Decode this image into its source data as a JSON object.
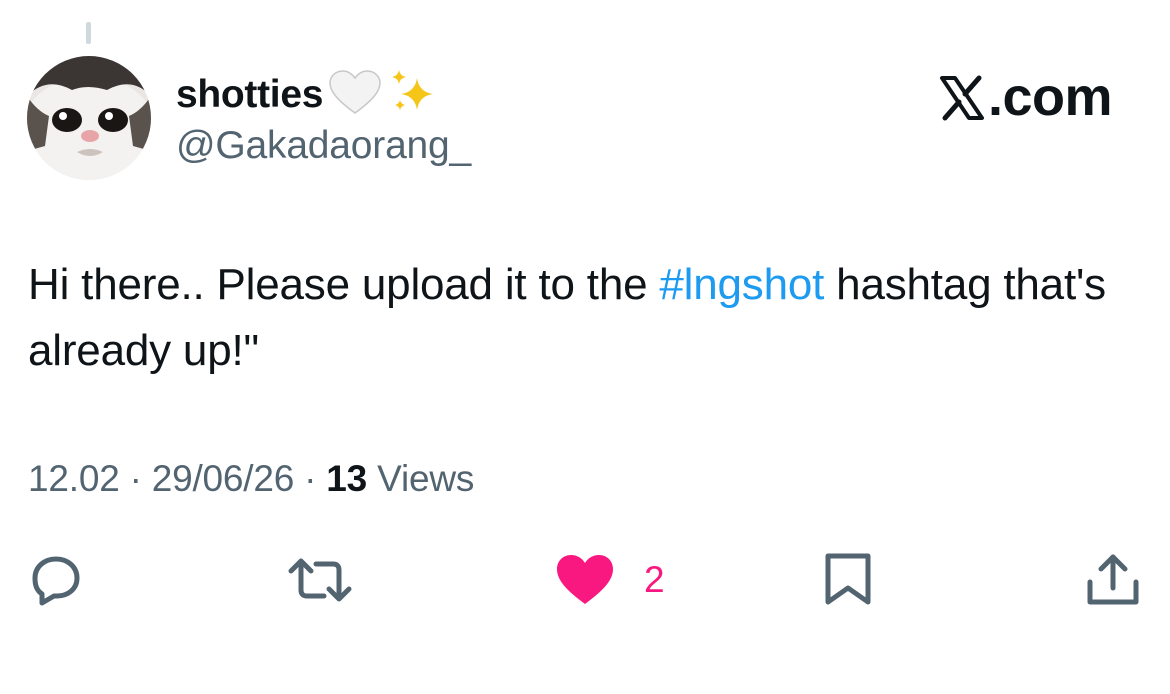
{
  "post": {
    "author": {
      "display_name": "shotties",
      "name_emojis": [
        "white-heart",
        "sparkles"
      ],
      "handle": "@Gakadaorang_",
      "avatar": "cat-face-avatar"
    },
    "brand": {
      "icon": "x-logo",
      "label": ".com"
    },
    "text": {
      "before": "Hi there.. Please upload it to the ",
      "hashtag": "#lngshot",
      "after": " hashtag that's already up!\""
    },
    "meta": {
      "time": "12.02",
      "separator": "·",
      "date": "29/06/26",
      "views_count": "13",
      "views_label": "Views"
    },
    "actions": {
      "reply_icon": "reply-icon",
      "repost_icon": "repost-icon",
      "like_icon": "heart-filled-icon",
      "like_count": "2",
      "bookmark_icon": "bookmark-icon",
      "share_icon": "share-icon"
    },
    "colors": {
      "hashtag": "#1d9bf0",
      "like": "#f91880",
      "muted": "#536471",
      "text": "#0f1419"
    }
  }
}
